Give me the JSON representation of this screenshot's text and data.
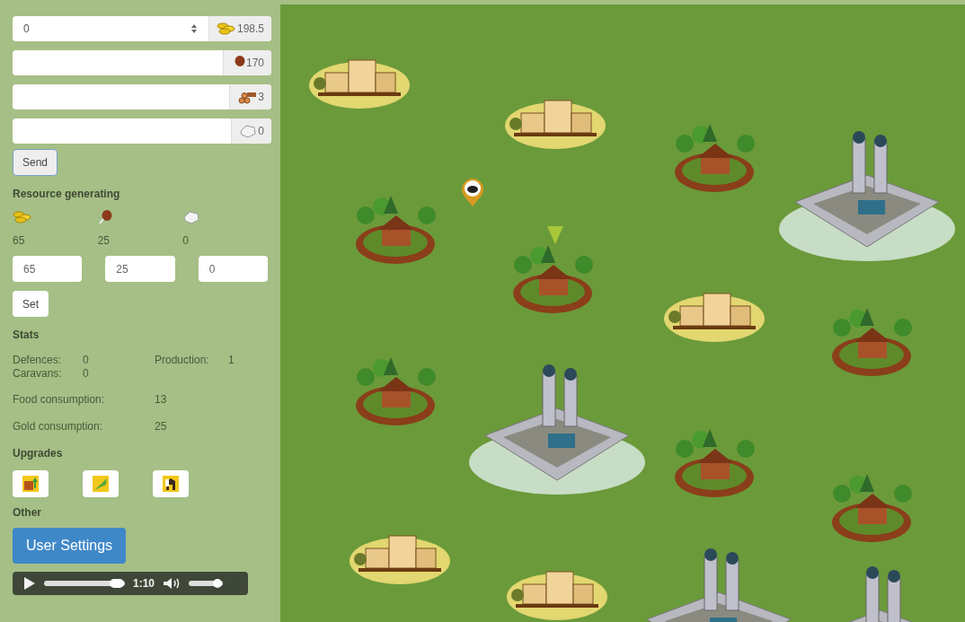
{
  "transfer": {
    "rows": [
      {
        "kind": "gold",
        "value": "0",
        "spinner": true,
        "amount": "198.5"
      },
      {
        "kind": "food",
        "spinner": false,
        "amount": "170"
      },
      {
        "kind": "wood",
        "spinner": false,
        "amount": "3"
      },
      {
        "kind": "stone",
        "spinner": false,
        "amount": "0"
      }
    ],
    "send_button": "Send"
  },
  "resource_generating": {
    "title": "Resource generating",
    "items": [
      {
        "kind": "gold",
        "reading": "65",
        "value": "65"
      },
      {
        "kind": "food",
        "reading": "25",
        "value": "25"
      },
      {
        "kind": "stone",
        "reading": "0",
        "value": "0"
      }
    ],
    "set_button": "Set"
  },
  "stats": {
    "title": "Stats",
    "pairs": [
      {
        "label": "Defences:",
        "value": "0"
      },
      {
        "label": "Production:",
        "value": "1"
      },
      {
        "label": "Caravans:",
        "value": "0"
      }
    ],
    "lines": [
      {
        "label": "Food consumption:",
        "value": "13"
      },
      {
        "label": "Gold consumption:",
        "value": "25"
      }
    ]
  },
  "upgrades": {
    "title": "Upgrades",
    "items": [
      {
        "kind": "fence"
      },
      {
        "kind": "field"
      },
      {
        "kind": "horse"
      }
    ]
  },
  "other": {
    "title": "Other",
    "user_settings_button": "User Settings"
  },
  "audio_player": {
    "time": "1:10",
    "progress": {
      "level": 0.9
    },
    "volume": {
      "level": 0.85
    }
  }
}
